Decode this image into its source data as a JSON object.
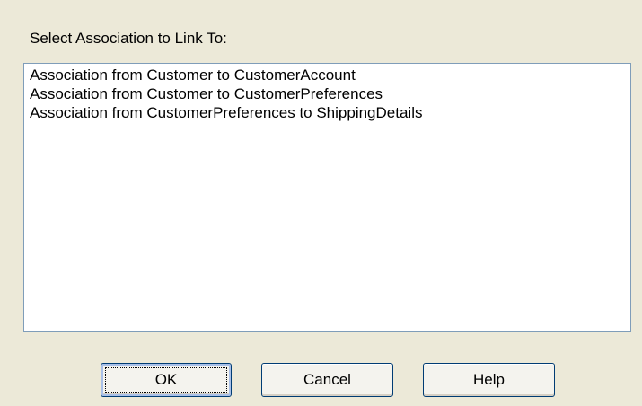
{
  "dialog": {
    "prompt_label": "Select Association to Link To:",
    "associations": [
      "Association from Customer to CustomerAccount",
      "Association from Customer to CustomerPreferences",
      "Association from CustomerPreferences to ShippingDetails"
    ],
    "buttons": {
      "ok_label": "OK",
      "cancel_label": "Cancel",
      "help_label": "Help"
    }
  },
  "colors": {
    "dialog_background": "#ece9d8",
    "listbox_background": "#ffffff",
    "listbox_border": "#7f9db9",
    "button_border": "#003c74"
  }
}
